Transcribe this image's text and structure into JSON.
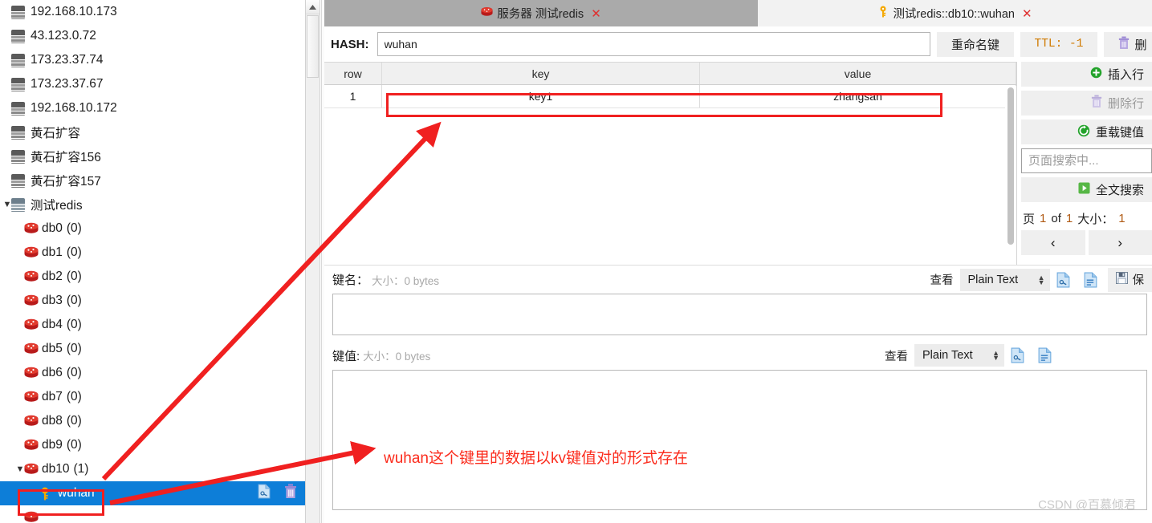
{
  "sidebar": {
    "servers": [
      {
        "icon": "server-icon",
        "label": "192.168.10.173"
      },
      {
        "icon": "server-icon",
        "label": "43.123.0.72"
      },
      {
        "icon": "server-icon",
        "label": "173.23.37.74"
      },
      {
        "icon": "server-icon",
        "label": "173.23.37.67"
      },
      {
        "icon": "server-icon",
        "label": "192.168.10.172"
      },
      {
        "icon": "server-icon",
        "label": "黄石扩容"
      },
      {
        "icon": "server-icon",
        "label": "黄石扩容156"
      },
      {
        "icon": "server-icon",
        "label": "黄石扩容157"
      }
    ],
    "expanded_server": {
      "icon": "server-icon",
      "label": "测试redis",
      "twisty": "▼"
    },
    "databases": [
      {
        "icon": "redis-db-icon",
        "label": "db0",
        "count": "(0)"
      },
      {
        "icon": "redis-db-icon",
        "label": "db1",
        "count": "(0)"
      },
      {
        "icon": "redis-db-icon",
        "label": "db2",
        "count": "(0)"
      },
      {
        "icon": "redis-db-icon",
        "label": "db3",
        "count": "(0)"
      },
      {
        "icon": "redis-db-icon",
        "label": "db4",
        "count": "(0)"
      },
      {
        "icon": "redis-db-icon",
        "label": "db5",
        "count": "(0)"
      },
      {
        "icon": "redis-db-icon",
        "label": "db6",
        "count": "(0)"
      },
      {
        "icon": "redis-db-icon",
        "label": "db7",
        "count": "(0)"
      },
      {
        "icon": "redis-db-icon",
        "label": "db8",
        "count": "(0)"
      },
      {
        "icon": "redis-db-icon",
        "label": "db9",
        "count": "(0)"
      },
      {
        "icon": "redis-db-icon",
        "label": "db10",
        "count": "(1)",
        "twisty": "▼"
      }
    ],
    "selected_key": {
      "icon": "key-icon",
      "label": "wuhan",
      "action_icons": [
        "copy-key-icon",
        "delete-key-icon"
      ]
    },
    "selection_color": "#0d7ed8"
  },
  "tabs": [
    {
      "icon": "redis-server-icon",
      "label": "服务器 测试redis",
      "close": "✕",
      "active": false
    },
    {
      "icon": "key-icon",
      "label": "测试redis::db10::wuhan",
      "close": "✕",
      "active": true
    }
  ],
  "hash_toolbar": {
    "type_label": "HASH:",
    "key_value": "wuhan",
    "key_placeholder": "",
    "rename_button": "重命名键",
    "ttl_button": "TTL: -1",
    "delete_button": "删",
    "delete_icon": "trash-icon"
  },
  "table": {
    "columns": [
      "row",
      "key",
      "value"
    ],
    "rows": [
      {
        "row": "1",
        "key": "key1",
        "value": "zhangsan"
      }
    ]
  },
  "side_buttons": {
    "insert_row": {
      "label": "插入行",
      "icon": "plus-circle-icon"
    },
    "delete_row": {
      "label": "删除行",
      "icon": "trash-icon",
      "disabled": true
    },
    "reload_value": {
      "label": "重载键值",
      "icon": "reload-icon"
    },
    "search_placeholder": "页面搜索中...",
    "search_value": "",
    "fulltext_search": {
      "label": "全文搜索",
      "icon": "play-icon"
    },
    "pager": {
      "page_label": "页",
      "page_number": "1",
      "of_label": "of",
      "total_pages": "1",
      "size_label": "大小：",
      "size_value": "1",
      "prev": "‹",
      "next": "›"
    }
  },
  "key_name_section": {
    "title": "键名：",
    "size": "大小：0 bytes",
    "view_label": "查看",
    "format": "Plain Text",
    "icons": [
      "binary-view-icon",
      "text-view-icon"
    ],
    "save_label": "保",
    "save_icon": "save-icon",
    "content": ""
  },
  "key_value_section": {
    "title": "键值:",
    "size": "大小：0 bytes",
    "view_label": "查看",
    "format": "Plain Text",
    "icons": [
      "binary-view-icon",
      "text-view-icon"
    ],
    "content": ""
  },
  "annotations": {
    "note_text": "wuhan这个键里的数据以kv键值对的形式存在",
    "note_color": "#fb2b1c",
    "highlight_color": "#f02020"
  },
  "watermark": "CSDN @百慕倾君"
}
